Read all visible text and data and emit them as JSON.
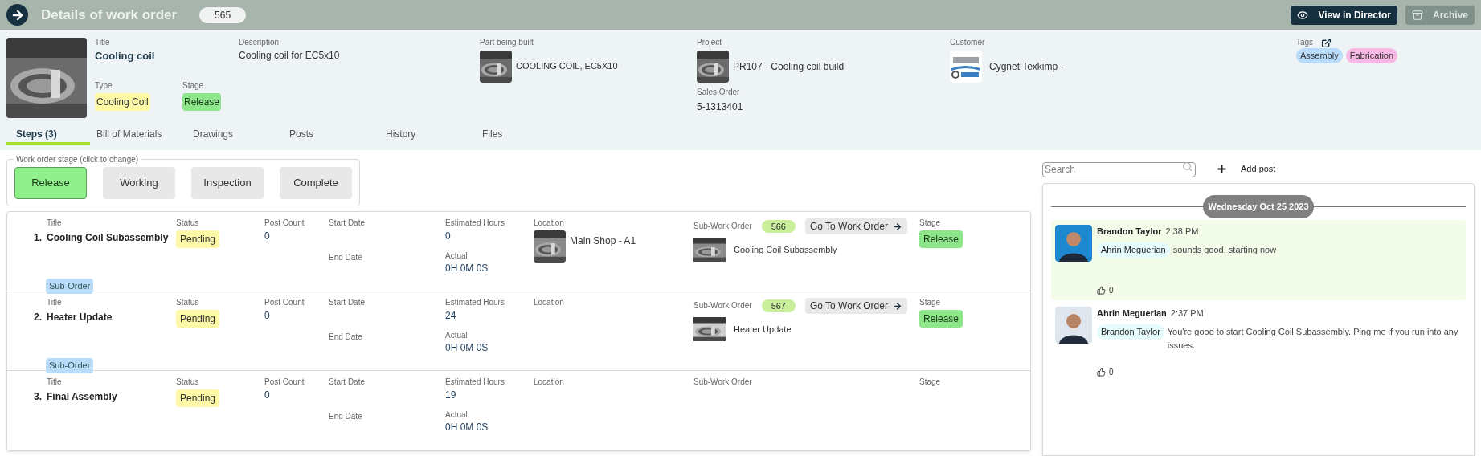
{
  "header": {
    "title": "Details of work order",
    "number": "565",
    "buttons": [
      {
        "label": "View in Director",
        "kind": "primary"
      },
      {
        "label": "Archive",
        "kind": "disabled"
      }
    ]
  },
  "info": {
    "title_label": "Title",
    "title": "Cooling coil",
    "description_label": "Description",
    "description": "Cooling coil for EC5x10",
    "part_label": "Part being built",
    "part": "COOLING COIL, EC5X10",
    "project_label": "Project",
    "project": "PR107 - Cooling coil build",
    "sales_order_label": "Sales Order",
    "sales_order": "5-1313401",
    "customer_label": "Customer",
    "customer": "Cygnet Texkimp -",
    "type_label": "Type",
    "type": "Cooling Coil",
    "stage_label": "Stage",
    "stage": "Release",
    "tags_label": "Tags",
    "tags": [
      {
        "label": "Assembly",
        "color": "#b9dcfb"
      },
      {
        "label": "Fabrication",
        "color": "#f8b8e4"
      }
    ]
  },
  "tabs": [
    {
      "label": "Steps (3)",
      "selected": true
    },
    {
      "label": "Bill of Materials",
      "selected": false
    },
    {
      "label": "Drawings",
      "selected": false
    },
    {
      "label": "Posts",
      "selected": false
    },
    {
      "label": "History",
      "selected": false
    },
    {
      "label": "Files",
      "selected": false
    }
  ],
  "stage_picker": {
    "legend": "Work order stage (click to change)",
    "stages": [
      {
        "label": "Release",
        "selected": true
      },
      {
        "label": "Working",
        "selected": false
      },
      {
        "label": "Inspection",
        "selected": false
      },
      {
        "label": "Complete",
        "selected": false
      }
    ]
  },
  "steps": [
    {
      "number": "1.",
      "title": "Cooling Coil Subassembly",
      "status": "Pending",
      "post_count": "0",
      "estimated_hours": "0",
      "actual": "0H 0M 0S",
      "location": "Main Shop - A1",
      "sub_work_order": {
        "number": "566",
        "button": "Go To Work Order",
        "name": "Cooling Coil Subassembly"
      },
      "stage": "Release",
      "tag": "Sub-Order",
      "labels": {
        "title": "Title",
        "status": "Status",
        "post_count": "Post Count",
        "start_date": "Start Date",
        "end_date": "End Date",
        "estimated_hours": "Estimated Hours",
        "actual": "Actual",
        "location": "Location",
        "sub_work_order": "Sub-Work Order",
        "stage": "Stage"
      }
    },
    {
      "number": "2.",
      "title": "Heater Update",
      "status": "Pending",
      "post_count": "0",
      "estimated_hours": "24",
      "actual": "0H 0M 0S",
      "sub_work_order": {
        "number": "567",
        "button": "Go To Work Order",
        "name": "Heater Update"
      },
      "stage": "Release",
      "tag": "Sub-Order",
      "labels": {
        "title": "Title",
        "status": "Status",
        "post_count": "Post Count",
        "start_date": "Start Date",
        "end_date": "End Date",
        "estimated_hours": "Estimated Hours",
        "actual": "Actual",
        "location": "Location",
        "sub_work_order": "Sub-Work Order",
        "stage": "Stage"
      }
    },
    {
      "number": "3.",
      "title": "Final Assembly",
      "status": "Pending",
      "post_count": "0",
      "estimated_hours": "19",
      "actual": "0H 0M 0S",
      "labels": {
        "title": "Title",
        "status": "Status",
        "post_count": "Post Count",
        "start_date": "Start Date",
        "end_date": "End Date",
        "estimated_hours": "Estimated Hours",
        "actual": "Actual",
        "location": "Location",
        "sub_work_order": "Sub-Work Order",
        "stage": "Stage"
      }
    }
  ],
  "posts_panel": {
    "search": {
      "placeholder": "Search"
    },
    "add_post": "Add post",
    "date": "Wednesday Oct 25 2023",
    "posts": [
      {
        "author": "Brandon Taylor",
        "time": "2:38 PM",
        "mention": "Ahrin Meguerian",
        "text": "sounds good, starting now",
        "likes": "0",
        "highlighted": true
      },
      {
        "author": "Ahrin Meguerian",
        "time": "2:37 PM",
        "mention": "Brandon Taylor",
        "text": "You're good to start Cooling Coil Subassembly. Ping me if you run into any issues.",
        "likes": "0",
        "highlighted": false
      }
    ]
  }
}
